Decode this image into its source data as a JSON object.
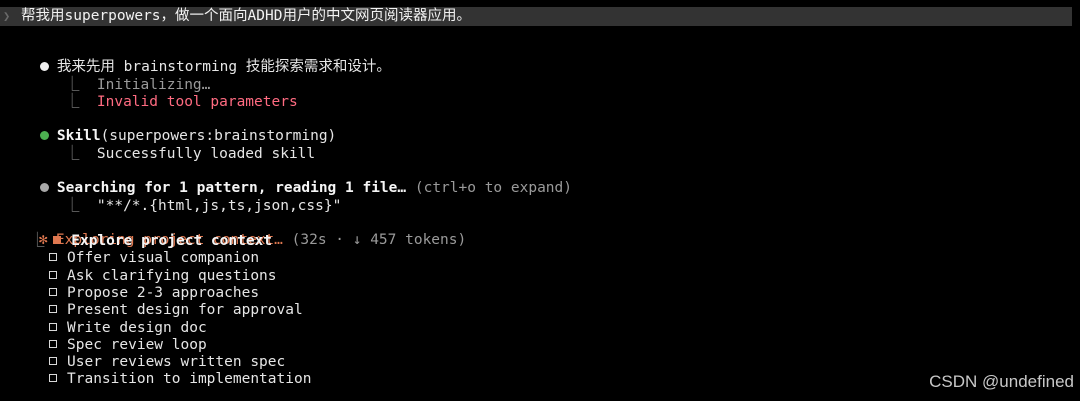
{
  "prompt": {
    "arrow_icon": "chevron-right-icon",
    "text": "帮我用superpowers，做一个面向ADHD用户的中文网页阅读器应用。"
  },
  "messages": [
    {
      "text": "我来先用 brainstorming 技能探索需求和设计。",
      "sub": [
        "Initializing…",
        "Invalid tool parameters"
      ]
    },
    {
      "text_name": "Skill",
      "text_args": "(superpowers:brainstorming)",
      "sub": [
        "Successfully loaded skill"
      ]
    },
    {
      "text": "Searching for 1 pattern, reading 1 file…",
      "hint": " (ctrl+o to expand)",
      "sub": [
        "\"**/*.{html,js,ts,json,css}\""
      ]
    }
  ],
  "task": {
    "glyph": "✻",
    "text": "Exploring project context…",
    "meta": " (32s · ↓ 457 tokens)",
    "todos": [
      {
        "label": "Explore project context",
        "active": true
      },
      {
        "label": "Offer visual companion",
        "active": false
      },
      {
        "label": "Ask clarifying questions",
        "active": false
      },
      {
        "label": "Propose 2-3 approaches",
        "active": false
      },
      {
        "label": "Present design for approval",
        "active": false
      },
      {
        "label": "Write design doc",
        "active": false
      },
      {
        "label": "Spec review loop",
        "active": false
      },
      {
        "label": "User reviews written spec",
        "active": false
      },
      {
        "label": "Transition to implementation",
        "active": false
      }
    ]
  },
  "watermark": "CSDN @undefined",
  "colors": {
    "background": "#000000",
    "prompt_bar": "#333333",
    "error": "#ff6b81",
    "success_dot": "#4caf50",
    "accent": "#e07850"
  }
}
